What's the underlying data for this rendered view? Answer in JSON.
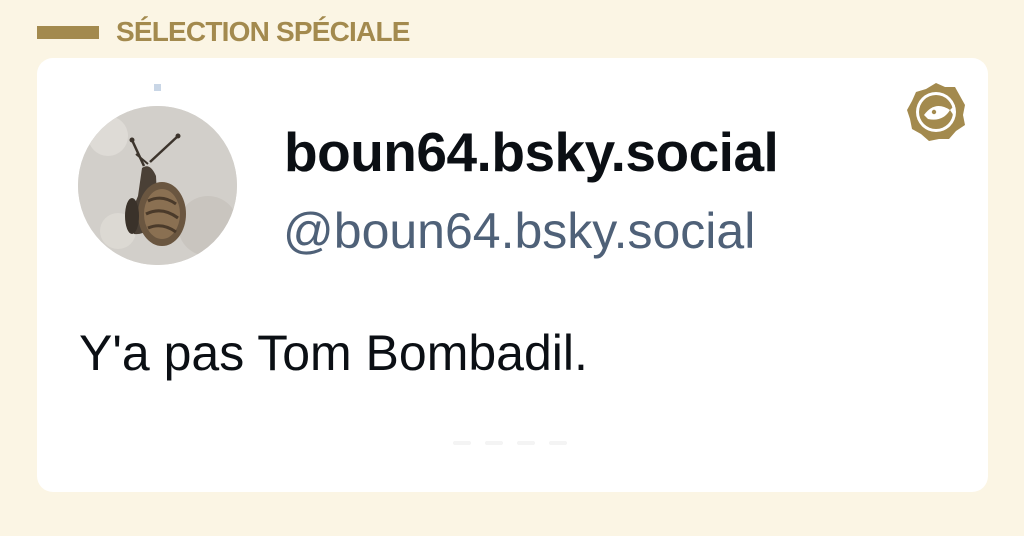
{
  "header": {
    "label": "SÉLECTION SPÉCIALE"
  },
  "post": {
    "display_name": "boun64.bsky.social",
    "handle": "@boun64.bsky.social",
    "text": "Y'a pas Tom Bombadil."
  },
  "icons": {
    "avatar": "snail-avatar-image",
    "badge": "fish-seal-badge-icon"
  },
  "colors": {
    "page_background": "#fbf5e4",
    "accent_gold": "#a38a4e",
    "card_background": "#ffffff",
    "name_text": "#0b0f14",
    "handle_text": "#4f6178"
  }
}
